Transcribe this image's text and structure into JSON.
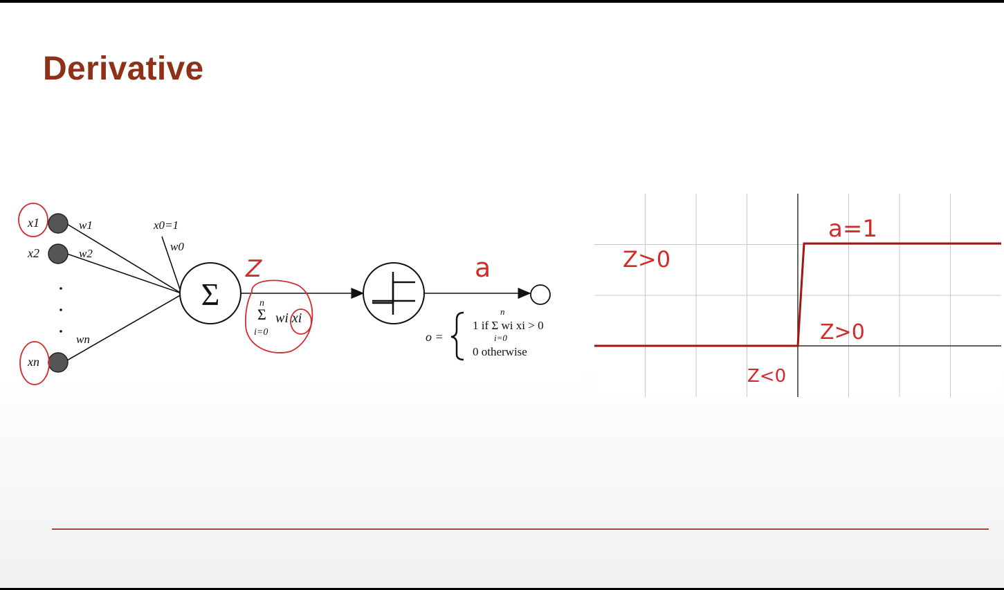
{
  "slide": {
    "title": "Derivative"
  },
  "perceptron": {
    "inputs": [
      "x1",
      "x2",
      "xn"
    ],
    "weights": [
      "w1",
      "w2",
      "wn"
    ],
    "bias_input": "x0=1",
    "bias_weight": "w0",
    "sum_symbol": "Σ",
    "sum_formula": {
      "upper": "n",
      "lower": "i=0",
      "body": "wi xi"
    },
    "output_eq": {
      "lhs": "o =",
      "case1": "1 if Σ wi xi > 0",
      "case1_upper": "n",
      "case1_lower": "i=0",
      "case2": "0 otherwise"
    }
  },
  "annotations": {
    "z": "Z",
    "a": "a",
    "a_eq_1": "a=1",
    "z_gt_0_left": "Z>0",
    "z_gt_0_right": "Z>0",
    "z_lt_0": "Z<0"
  },
  "chart_data": {
    "type": "line",
    "title": "",
    "xlabel": "",
    "ylabel": "",
    "grid": true,
    "series": [
      {
        "x": [
          -4,
          0,
          0,
          4
        ],
        "y": [
          0,
          0,
          1,
          1
        ]
      }
    ]
  },
  "colors": {
    "title": "#8f3118",
    "rule": "#a14a30",
    "ink": "#d42a2a",
    "step_line": "#a11515"
  }
}
